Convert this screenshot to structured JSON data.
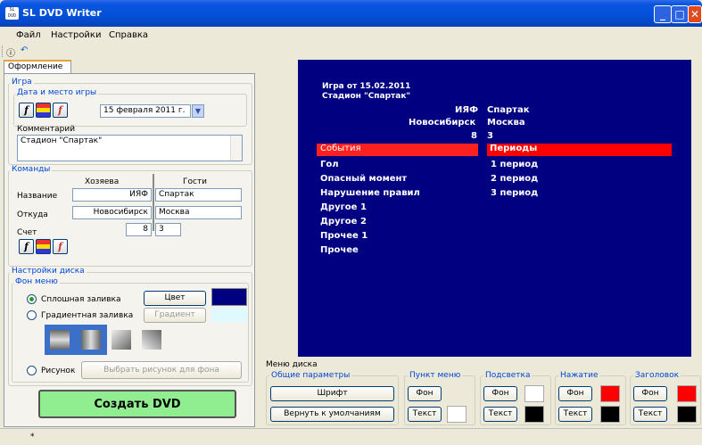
{
  "window": {
    "title": "SL DVD Writer",
    "icon_text": "SL DVD WRT",
    "buttons": [
      "minimize",
      "maximize",
      "close"
    ]
  },
  "menu": [
    "Файл",
    "Настройки",
    "Справка"
  ],
  "tabs": [
    "Оформление"
  ],
  "game": {
    "group_label": "Игра",
    "date_group_label": "Дата и место игры",
    "date_value": "15 февраля 2011 г.",
    "comment_label": "Комментарий",
    "comment_value": "Стадион \"Спартак\""
  },
  "teams": {
    "group_label": "Команды",
    "home_header": "Хозяева",
    "guest_header": "Гости",
    "name_label": "Название",
    "from_label": "Откуда",
    "score_label": "Счет",
    "home_name": "ИЯФ",
    "guest_name": "Спартак",
    "home_from": "Новосибирск",
    "guest_from": "Москва",
    "home_score": "8",
    "guest_score": "3"
  },
  "disk": {
    "group_label": "Настройки диска",
    "bg_group_label": "Фон меню",
    "solid_fill": "Сплошная заливка",
    "gradient_fill": "Градиентная заливка",
    "picture": "Рисунок",
    "color_button": "Цвет",
    "gradient_button": "Градиент",
    "picture_button": "Выбрать рисунок для фона",
    "solid_color": "#000080",
    "gradient_color": "#e0f8ff"
  },
  "create_button": "Создать DVD",
  "preview": {
    "title_line1": "Игра от 15.02.2011",
    "title_line2": "Стадион \"Спартак\"",
    "home_name": "ИЯФ",
    "guest_name": "Спартак",
    "home_from": "Новосибирск",
    "guest_from": "Москва",
    "home_score": "8",
    "guest_score": "3",
    "events_header": "События",
    "periods_header": "Периоды",
    "events": [
      "Гол",
      "Опасный момент",
      "Нарушение правил",
      "Другое 1",
      "Другое 2",
      "Прочее 1",
      "Прочее"
    ],
    "periods": [
      "1 период",
      "2 период",
      "3 период"
    ],
    "bg_color": "#000080",
    "highlight_color": "#ff0000"
  },
  "disk_menu": {
    "label": "Меню диска",
    "general_label": "Общие параметры",
    "font_button": "Шрифт",
    "reset_button": "Вернуть к умолчаниям",
    "menu_item_label": "Пункт меню",
    "highlight_label": "Подсветка",
    "press_label": "Нажатие",
    "header_label": "Заголовок",
    "bg_button": "Фон",
    "text_button": "Текст",
    "colors": {
      "menu_item_bg": "#ffffff",
      "menu_item_text": "#ffffff",
      "highlight_bg": "#ffffff",
      "highlight_text": "#000000",
      "press_bg": "#ff0000",
      "press_text": "#000000",
      "header_bg": "#ff0000",
      "header_text": "#000000"
    }
  },
  "status": {
    "text": "*"
  }
}
